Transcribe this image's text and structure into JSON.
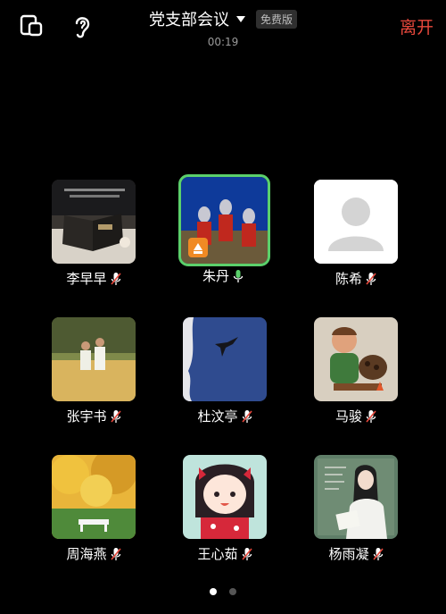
{
  "header": {
    "title": "党支部会议",
    "badge": "免费版",
    "timer": "00:19",
    "leave_label": "离开"
  },
  "participants": [
    {
      "name": "李早早",
      "mic": "muted",
      "avatar": "book-photo"
    },
    {
      "name": "朱丹",
      "mic": "active",
      "avatar": "ultraman-photo",
      "speaking": true
    },
    {
      "name": "陈希",
      "mic": "muted",
      "avatar": "default-avatar"
    },
    {
      "name": "张宇书",
      "mic": "muted",
      "avatar": "field-photo"
    },
    {
      "name": "杜汶亭",
      "mic": "muted",
      "avatar": "bird-photo"
    },
    {
      "name": "马骏",
      "mic": "muted",
      "avatar": "cartoon-photo"
    },
    {
      "name": "周海燕",
      "mic": "muted",
      "avatar": "autumn-photo"
    },
    {
      "name": "王心茹",
      "mic": "muted",
      "avatar": "anime-photo"
    },
    {
      "name": "杨雨凝",
      "mic": "muted",
      "avatar": "painting-photo"
    }
  ],
  "pagination": {
    "pages": 2,
    "current": 1
  },
  "colors": {
    "leave": "#e8483c",
    "active_border": "#5bd06b",
    "mic_active": "#5bd06b",
    "mic_muted": "#e8483c"
  }
}
